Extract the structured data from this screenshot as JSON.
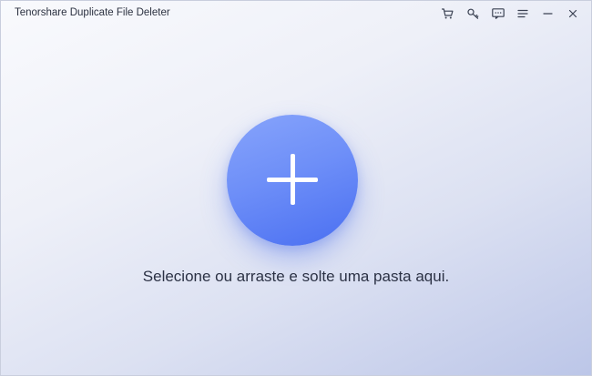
{
  "window": {
    "title": "Tenorshare Duplicate File Deleter"
  },
  "titlebar": {
    "icons": [
      {
        "name": "cart-icon"
      },
      {
        "name": "key-icon"
      },
      {
        "name": "feedback-icon"
      },
      {
        "name": "menu-icon"
      },
      {
        "name": "minimize-icon"
      },
      {
        "name": "close-icon"
      }
    ]
  },
  "main": {
    "add_icon": "plus-icon",
    "hint_text": "Selecione ou arraste e solte uma pasta aqui."
  },
  "colors": {
    "button_gradient_start": "#87a4fb",
    "button_gradient_end": "#4a6ff1",
    "text": "#2c3245"
  }
}
